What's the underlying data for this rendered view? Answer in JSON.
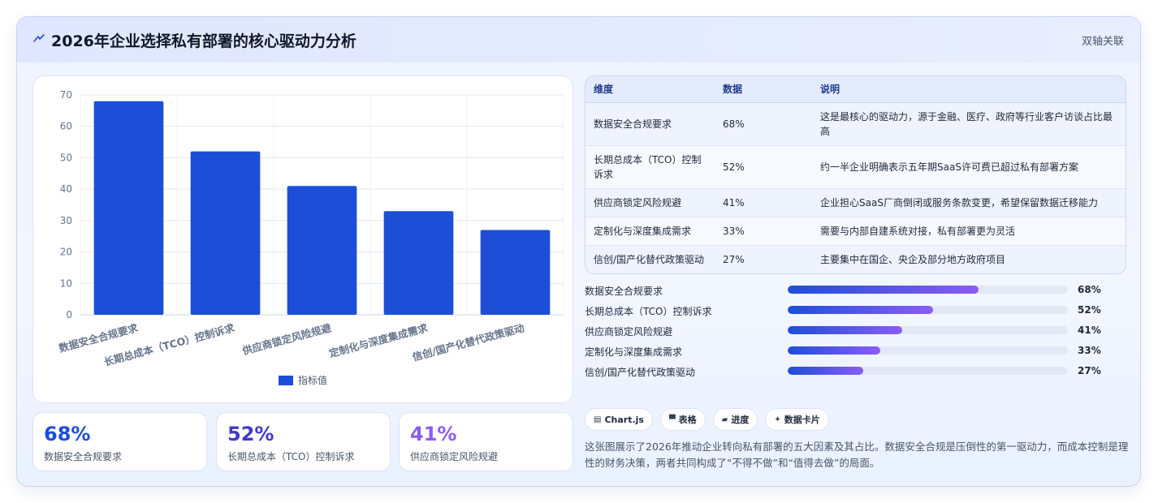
{
  "header": {
    "title": "2026年企业选择私有部署的核心驱动力分析",
    "tag": "双轴关联",
    "icon": "lightning-icon"
  },
  "chart_data": {
    "type": "bar",
    "categories": [
      "数据安全合规要求",
      "长期总成本（TCO）控制诉求",
      "供应商锁定风险规避",
      "定制化与深度集成需求",
      "信创/国产化替代政策驱动"
    ],
    "series": [
      {
        "name": "指标值",
        "values": [
          68,
          52,
          41,
          33,
          27
        ],
        "color": "#1d4ed8"
      }
    ],
    "ylim": [
      0,
      70
    ],
    "yticks": [
      0,
      10,
      20,
      30,
      40,
      50,
      60,
      70
    ],
    "grid": true,
    "legend_position": "bottom"
  },
  "stats": [
    {
      "value": "68%",
      "label": "数据安全合规要求",
      "color": "#1d4ed8"
    },
    {
      "value": "52%",
      "label": "长期总成本（TCO）控制诉求",
      "color": "#4338ca"
    },
    {
      "value": "41%",
      "label": "供应商锁定风险规避",
      "color": "#8b5cf6"
    }
  ],
  "table": {
    "headers": [
      "维度",
      "数据",
      "说明"
    ],
    "rows": [
      [
        "数据安全合规要求",
        "68%",
        "这是最核心的驱动力，源于金融、医疗、政府等行业客户访谈占比最高"
      ],
      [
        "长期总成本（TCO）控制诉求",
        "52%",
        "约一半企业明确表示五年期SaaS许可费已超过私有部署方案"
      ],
      [
        "供应商锁定风险规避",
        "41%",
        "企业担心SaaS厂商倒闭或服务条款变更，希望保留数据迁移能力"
      ],
      [
        "定制化与深度集成需求",
        "33%",
        "需要与内部自建系统对接，私有部署更为灵活"
      ],
      [
        "信创/国产化替代政策驱动",
        "27%",
        "主要集中在国企、央企及部分地方政府项目"
      ]
    ]
  },
  "progress": [
    {
      "label": "数据安全合规要求",
      "value": "68%",
      "fraction": 0.68
    },
    {
      "label": "长期总成本（TCO）控制诉求",
      "value": "52%",
      "fraction": 0.52
    },
    {
      "label": "供应商锁定风险规避",
      "value": "41%",
      "fraction": 0.41
    },
    {
      "label": "定制化与深度集成需求",
      "value": "33%",
      "fraction": 0.33
    },
    {
      "label": "信创/国产化替代政策驱动",
      "value": "27%",
      "fraction": 0.27
    }
  ],
  "chips": [
    {
      "icon": "chart-icon",
      "glyph": "▤",
      "label": "Chart.js"
    },
    {
      "icon": "table-icon",
      "glyph": "▀",
      "label": "表格"
    },
    {
      "icon": "progress-icon",
      "glyph": "▰",
      "label": "进度"
    },
    {
      "icon": "card-icon",
      "glyph": "✦",
      "label": "数据卡片"
    }
  ],
  "summary": "这张图展示了2026年推动企业转向私有部署的五大因素及其占比。数据安全合规是压倒性的第一驱动力，而成本控制是理性的财务决策，两者共同构成了“不得不做”和“值得去做”的局面。"
}
